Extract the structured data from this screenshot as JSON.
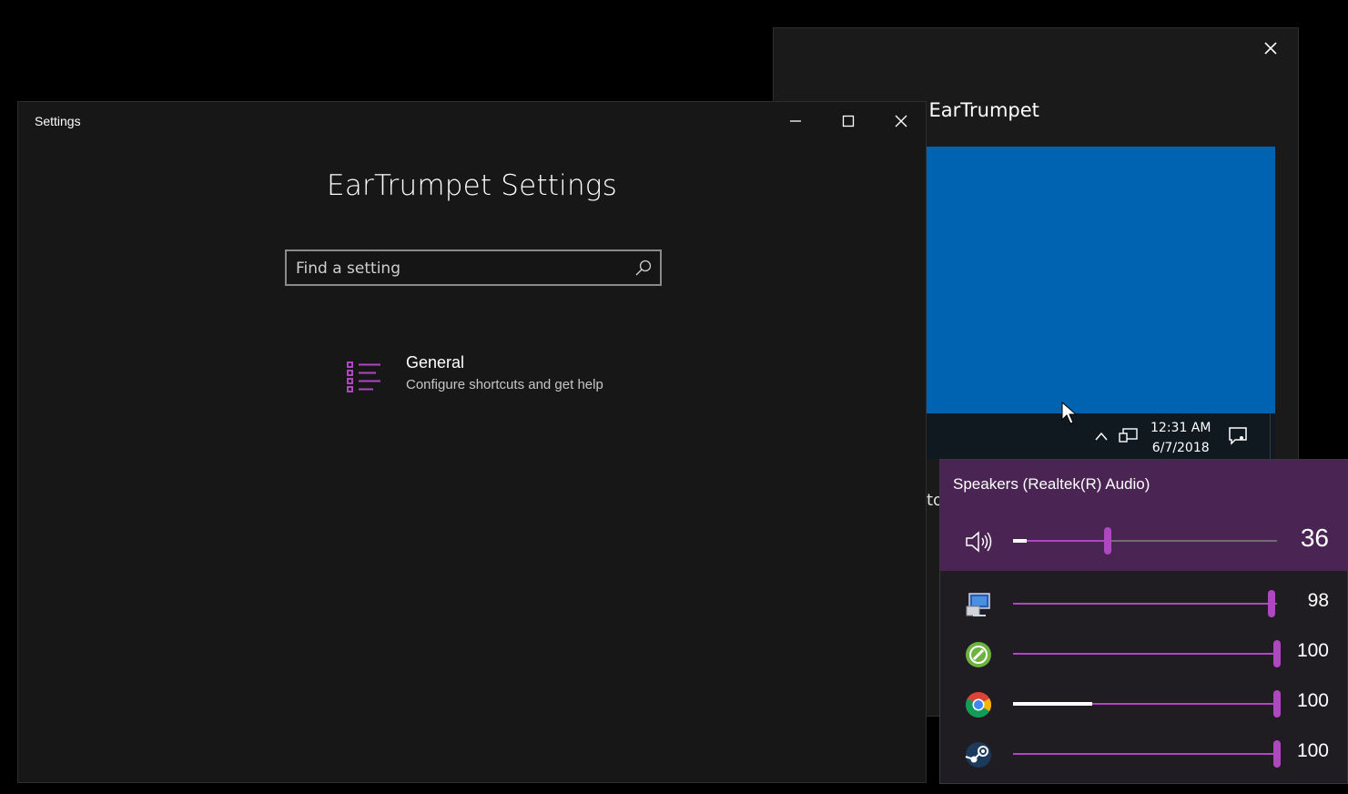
{
  "welcome": {
    "title": "Welcome to EarTrumpet",
    "clock_time": "12:31 AM",
    "clock_date": "6/7/2018",
    "stub_text": "to"
  },
  "settings": {
    "window_title": "Settings",
    "heading": "EarTrumpet Settings",
    "search_placeholder": "Find a setting",
    "general_title": "General",
    "general_subtitle": "Configure shortcuts and get help"
  },
  "flyout": {
    "device_name": "Speakers (Realtek(R) Audio)",
    "master": {
      "icon": "speaker-icon",
      "volume": 36,
      "peak": 0.05
    },
    "apps": [
      {
        "icon": "system-sounds-icon",
        "volume": 98,
        "peak": 0
      },
      {
        "icon": "app-green-icon",
        "volume": 100,
        "peak": 0
      },
      {
        "icon": "chrome-icon",
        "volume": 100,
        "peak": 0.3
      },
      {
        "icon": "steam-icon",
        "volume": 100,
        "peak": 0
      }
    ]
  },
  "colors": {
    "accent": "#b146c2",
    "flyout_header": "#4a2553",
    "preview_blue": "#0063b1"
  }
}
